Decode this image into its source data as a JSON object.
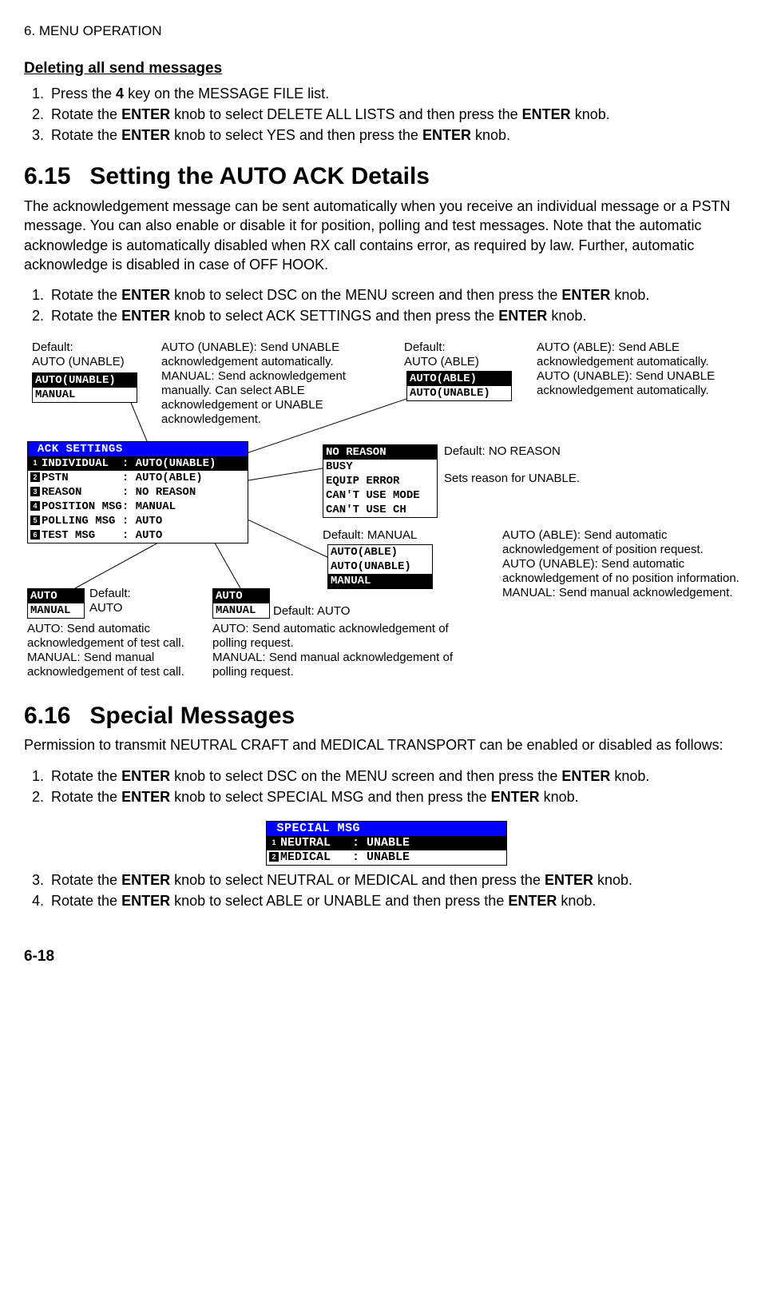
{
  "header": "6. MENU OPERATION",
  "deleting": {
    "title": "Deleting all send messages",
    "steps": [
      "Press the <b>4</b> key on the MESSAGE FILE list.",
      "Rotate the <b>ENTER</b> knob to select DELETE ALL LISTS and then press the <b>ENTER</b> knob.",
      "Rotate the <b>ENTER</b> knob to select YES and then press the <b>ENTER</b> knob."
    ]
  },
  "section615": {
    "num": "6.15",
    "title": "Setting the AUTO ACK Details",
    "intro": "The acknowledgement message can be sent automatically when you receive an individual message or a PSTN message. You can also enable or disable it for position, polling and test messages. Note that the automatic acknowledge is automatically disabled when RX call contains error, as required by law. Further, automatic acknowledge is disabled in case of OFF HOOK.",
    "steps": [
      "Rotate the <b>ENTER</b> knob to select DSC on the MENU screen and then press the <b>ENTER</b> knob.",
      "Rotate the <b>ENTER</b> knob to select ACK SETTINGS and then press the <b>ENTER</b> knob."
    ]
  },
  "diagram": {
    "individual": {
      "default": "Default:\nAUTO (UNABLE)",
      "options": [
        "AUTO(UNABLE)",
        "MANUAL"
      ],
      "desc": "AUTO (UNABLE): Send UNABLE acknowledgement automatically.\nMANUAL: Send acknowledgement manually. Can select ABLE acknowledgement or UNABLE acknowledgement."
    },
    "pstn": {
      "default": "Default:\nAUTO (ABLE)",
      "options": [
        "AUTO(ABLE)",
        "AUTO(UNABLE)"
      ],
      "desc": "AUTO (ABLE): Send ABLE acknowledgement automatically.\nAUTO (UNABLE): Send UNABLE acknowledgement automatically."
    },
    "ack_settings": {
      "title": " ACK SETTINGS",
      "rows": [
        {
          "idx": "1",
          "label": "INDIVIDUAL",
          "val": "AUTO(UNABLE)",
          "sel": true
        },
        {
          "idx": "2",
          "label": "PSTN",
          "val": "AUTO(ABLE)"
        },
        {
          "idx": "3",
          "label": "REASON",
          "val": "NO REASON"
        },
        {
          "idx": "4",
          "label": "POSITION MSG",
          "val": "MANUAL"
        },
        {
          "idx": "5",
          "label": "POLLING MSG",
          "val": "AUTO"
        },
        {
          "idx": "6",
          "label": "TEST MSG",
          "val": "AUTO"
        }
      ]
    },
    "reason": {
      "default": "Default: NO REASON",
      "desc": "Sets reason for UNABLE.",
      "options": [
        "NO REASON",
        "BUSY",
        "EQUIP ERROR",
        "CAN'T USE MODE",
        "CAN'T USE CH"
      ]
    },
    "position": {
      "default": "Default: MANUAL",
      "options": [
        "AUTO(ABLE)",
        "AUTO(UNABLE)",
        "MANUAL"
      ],
      "desc": "AUTO (ABLE): Send automatic acknowledgement of position request.\nAUTO (UNABLE): Send automatic acknowledgement of no position information.\nMANUAL: Send manual acknowledgement."
    },
    "test": {
      "default": "Default:\nAUTO",
      "options": [
        "AUTO",
        "MANUAL"
      ],
      "desc": "AUTO: Send automatic acknowledgement of test call.\nMANUAL: Send manual acknowledgement of test call."
    },
    "polling": {
      "default": "Default: AUTO",
      "options": [
        "AUTO",
        "MANUAL"
      ],
      "desc": "AUTO: Send automatic acknowledgement of polling request.\nMANUAL: Send manual acknowledgement of polling request."
    }
  },
  "section616": {
    "num": "6.16",
    "title": "Special Messages",
    "intro": "Permission to transmit NEUTRAL CRAFT and MEDICAL TRANSPORT can be enabled or disabled as follows:",
    "steps12": [
      "Rotate the <b>ENTER</b> knob to select DSC on the MENU screen and then press the <b>ENTER</b> knob.",
      "Rotate the <b>ENTER</b> knob to select SPECIAL MSG and then press the <b>ENTER</b> knob."
    ],
    "box": {
      "title": " SPECIAL MSG",
      "rows": [
        {
          "idx": "1",
          "label": "NEUTRAL",
          "val": "UNABLE",
          "sel": true
        },
        {
          "idx": "2",
          "label": "MEDICAL",
          "val": "UNABLE"
        }
      ]
    },
    "steps34": [
      "Rotate the <b>ENTER</b> knob to select NEUTRAL or MEDICAL and then press the <b>ENTER</b> knob.",
      "Rotate the <b>ENTER</b> knob to select ABLE or UNABLE and then press the <b>ENTER</b> knob."
    ]
  },
  "page": "6-18"
}
